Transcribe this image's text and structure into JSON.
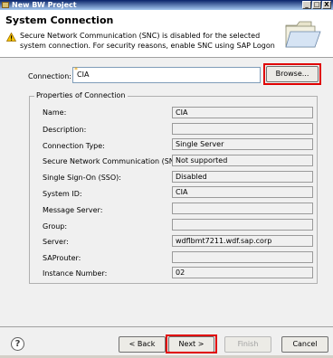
{
  "window": {
    "title": "New BW Project",
    "minimize": "_",
    "maximize": "□",
    "close": "X"
  },
  "header": {
    "title": "System Connection",
    "message": "Secure Network Communication (SNC) is disabled for the selected system connection. For security reasons, enable SNC using SAP Logon"
  },
  "connection": {
    "label": "Connection:",
    "value": "CIA",
    "required_marker": "*",
    "browse_label": "Browse..."
  },
  "properties": {
    "group_title": "Properties of Connection",
    "rows": [
      {
        "label": "Name:",
        "value": "CIA"
      },
      {
        "label": "Description:",
        "value": ""
      },
      {
        "label": "Connection Type:",
        "value": "Single Server"
      },
      {
        "label": "Secure Network Communication (SNC):",
        "value": "Not supported"
      },
      {
        "label": "Single Sign-On (SSO):",
        "value": "Disabled"
      },
      {
        "label": "System ID:",
        "value": "CIA"
      },
      {
        "label": "Message Server:",
        "value": ""
      },
      {
        "label": "Group:",
        "value": ""
      },
      {
        "label": "Server:",
        "value": "wdflbmt7211.wdf.sap.corp"
      },
      {
        "label": "SAProuter:",
        "value": ""
      },
      {
        "label": "Instance Number:",
        "value": "02"
      }
    ]
  },
  "footer": {
    "help": "?",
    "back": "< Back",
    "next": "Next >",
    "finish": "Finish",
    "cancel": "Cancel"
  },
  "colors": {
    "highlight": "#e00000",
    "titlebar": "#0a246a"
  }
}
